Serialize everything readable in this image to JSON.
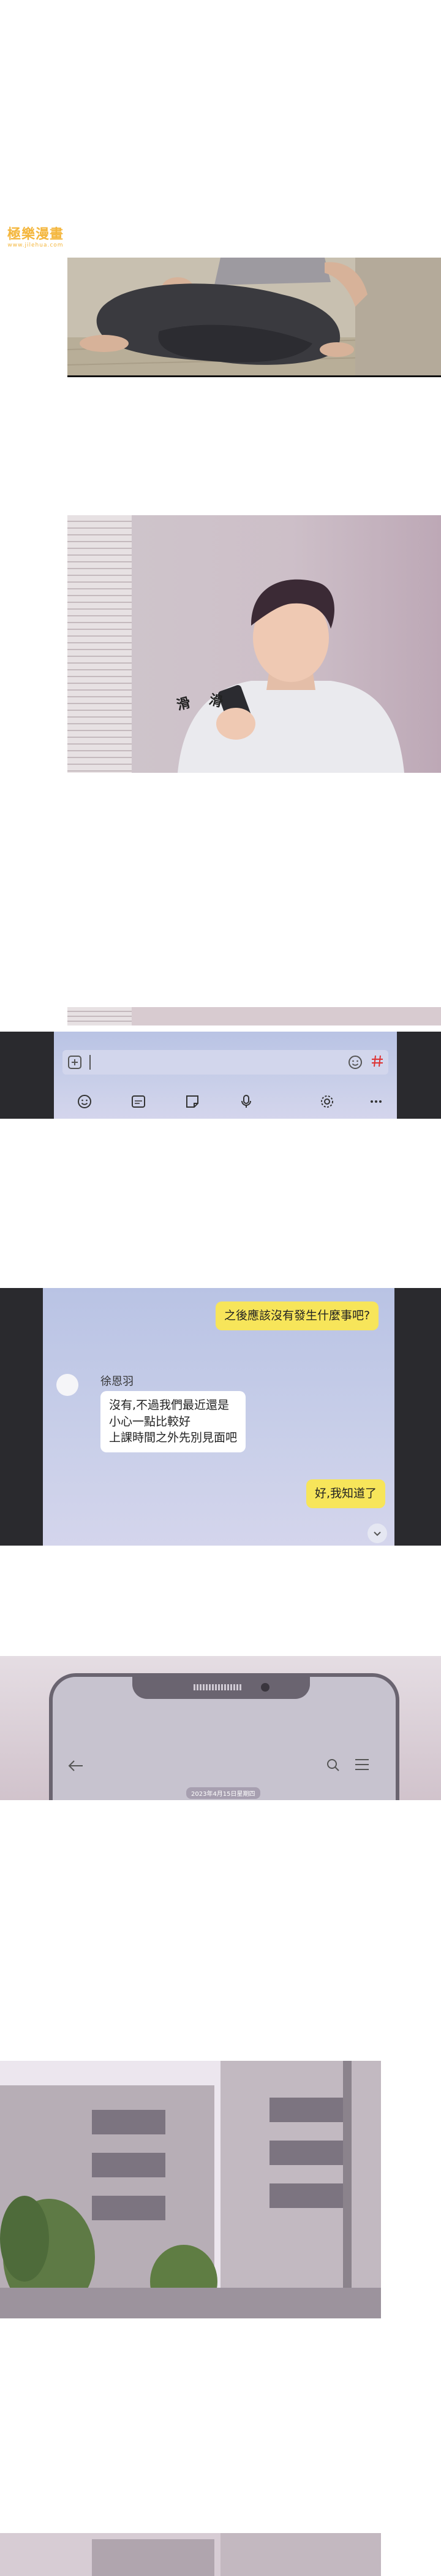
{
  "watermark": {
    "title": "極樂漫畫",
    "subtitle": "www.jilehua.com"
  },
  "panel2": {
    "sfx_left": "滑",
    "sfx_right": "滑"
  },
  "input_bar": {
    "plus_icon": "plus-icon",
    "emoji_icon": "emoji-icon",
    "hash_icon": "hash-icon",
    "toolbar_icons": [
      "smile-icon",
      "gif-icon",
      "sticker-icon",
      "mic-icon",
      "gear-icon",
      "more-icon"
    ]
  },
  "chat": {
    "sender_name": "徐恩羽",
    "outgoing_1": "之後應該沒有發生什麼事吧?",
    "incoming_1": "沒有,不過我們最近還是\n小心一點比較好\n上課時間之外先別見面吧",
    "outgoing_2": "好,我知道了"
  },
  "phone_header": {
    "date_label": "2023年4月15日星期四"
  },
  "colors": {
    "chat_bg": "#c4cbe8",
    "outgoing_bubble": "#f7e55a",
    "incoming_bubble": "#ffffff",
    "phone_frame": "#2a2a2e",
    "watermark": "#f4b63c"
  }
}
